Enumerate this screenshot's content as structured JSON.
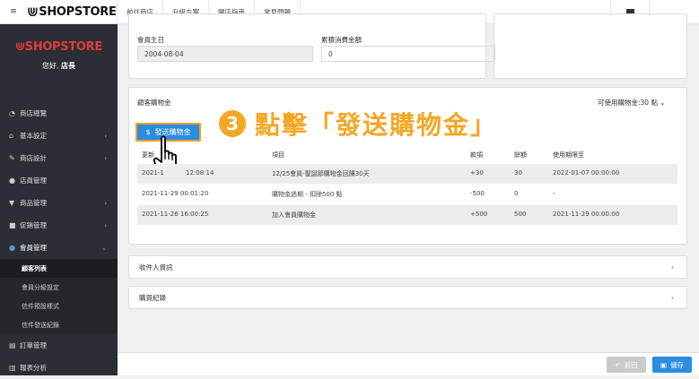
{
  "topbar": {
    "logo": "SHOPSTORE",
    "nav": [
      "前往商店",
      "升級方案",
      "開店指南",
      "常見問題"
    ]
  },
  "sidebar": {
    "logo": "SHOPSTORE",
    "greeting": "您好,",
    "user": "店長",
    "items": [
      {
        "label": "商店總覽",
        "icon": "dashboard-icon",
        "chevron": false
      },
      {
        "label": "基本設定",
        "icon": "bank-icon",
        "chevron": true
      },
      {
        "label": "商店設計",
        "icon": "brush-icon",
        "chevron": true
      },
      {
        "label": "店員管理",
        "icon": "user-icon",
        "chevron": false
      },
      {
        "label": "商品管理",
        "icon": "cart-icon",
        "chevron": true
      },
      {
        "label": "促銷管理",
        "icon": "gift-icon",
        "chevron": true
      },
      {
        "label": "會員管理",
        "icon": "users-icon",
        "chevron": true
      }
    ],
    "subitems": [
      "顧客列表",
      "會員分級設定",
      "信件預設樣式",
      "信件發送紀錄"
    ],
    "items_after": [
      {
        "label": "訂單管理",
        "icon": "orders-icon"
      },
      {
        "label": "報表分析",
        "icon": "report-icon"
      }
    ]
  },
  "profile": {
    "birthday_label": "會員生日",
    "birthday_value": "2004-08-04",
    "total_label": "累積消費金額",
    "total_value": "0"
  },
  "credit": {
    "title": "顧客購物金",
    "available": "可使用購物金:30 點",
    "send_button": "發送購物金",
    "annotation_num": "3",
    "annotation_text": "點擊「發送購物金」",
    "headers": [
      "更新",
      "項目",
      "款項",
      "餘額",
      "使用期限至"
    ],
    "rows": [
      [
        "2021-1",
        "12:08:14",
        "12/25會員-聖誕節購物金回饋30天",
        "+30",
        "30",
        "2022-01-07 00:00:00"
      ],
      [
        "2021-11-29 00:01:20",
        "",
        "購物金過期 - 扣除500 點",
        "-500",
        "0",
        "-"
      ],
      [
        "2021-11-26 16:00:25",
        "",
        "加入會員購物金",
        "+500",
        "500",
        "2021-11-29 00:00:00"
      ]
    ]
  },
  "sections": [
    "收件人資訊",
    "購買紀錄"
  ],
  "footer": {
    "back": "返回",
    "save": "儲存"
  },
  "colors": {
    "primary": "#2b8de0",
    "annotation": "#f5a623",
    "sidebar": "#2b2f35"
  }
}
